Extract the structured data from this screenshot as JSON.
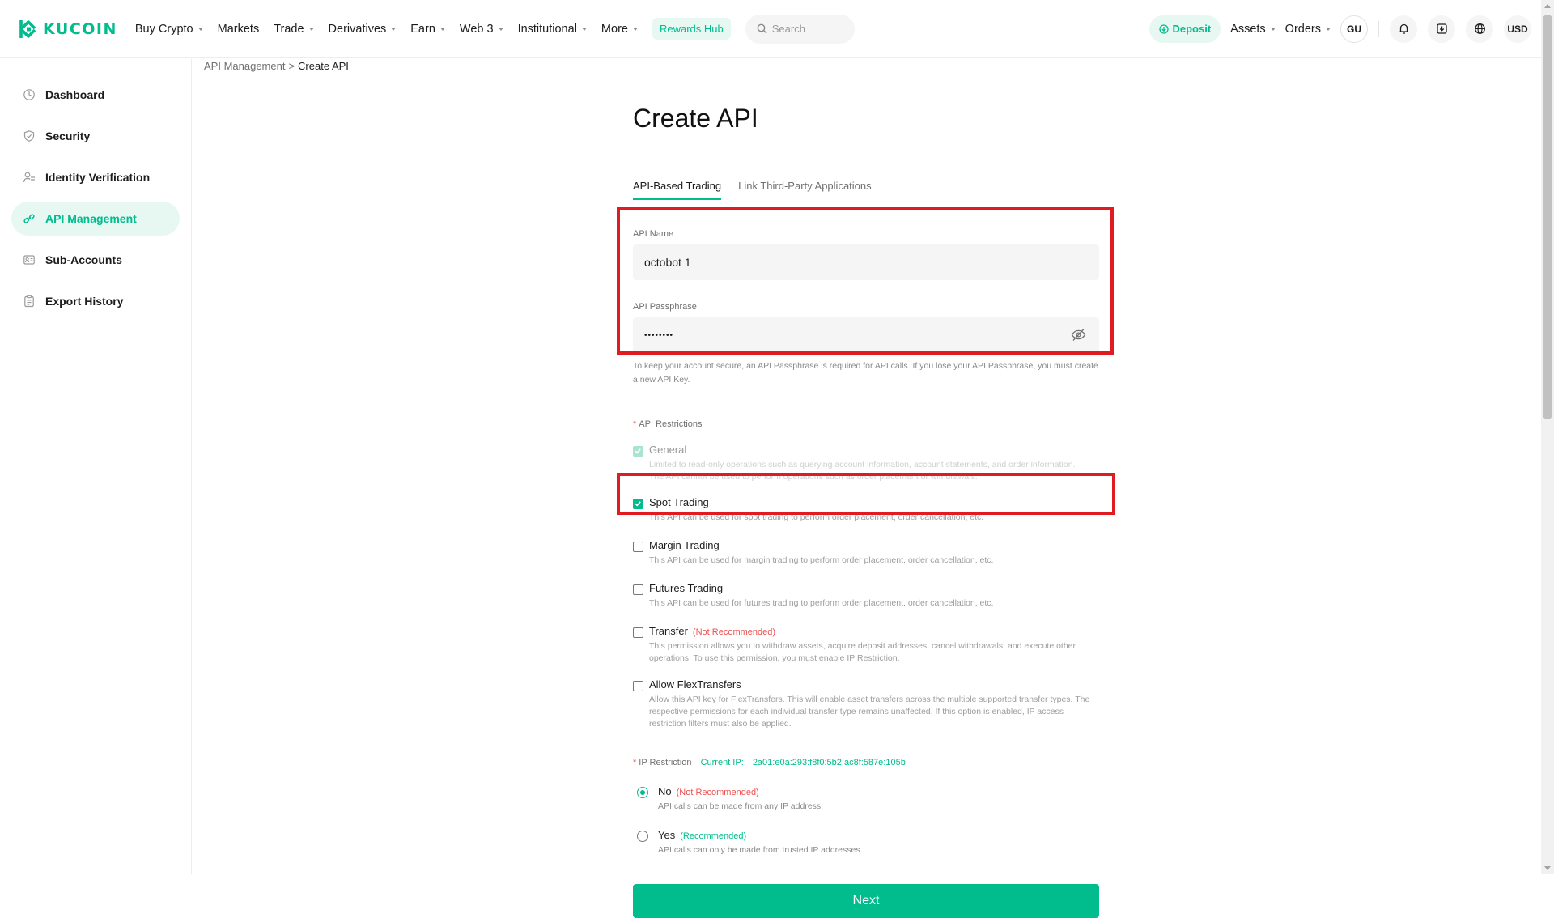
{
  "brand": {
    "name": "KUCOIN",
    "color": "#01bc8d"
  },
  "nav": {
    "items": [
      {
        "label": "Buy Crypto",
        "dropdown": true
      },
      {
        "label": "Markets",
        "dropdown": false
      },
      {
        "label": "Trade",
        "dropdown": true
      },
      {
        "label": "Derivatives",
        "dropdown": true
      },
      {
        "label": "Earn",
        "dropdown": true
      },
      {
        "label": "Web 3",
        "dropdown": true
      },
      {
        "label": "Institutional",
        "dropdown": true
      },
      {
        "label": "More",
        "dropdown": true
      }
    ],
    "rewards": "Rewards Hub",
    "search_placeholder": "Search",
    "deposit": "Deposit",
    "assets": "Assets",
    "orders": "Orders",
    "avatar": "GU",
    "currency": "USD"
  },
  "sidebar": {
    "items": [
      {
        "label": "Dashboard",
        "icon": "dashboard-icon",
        "active": false
      },
      {
        "label": "Security",
        "icon": "shield-icon",
        "active": false
      },
      {
        "label": "Identity Verification",
        "icon": "user-check-icon",
        "active": false
      },
      {
        "label": "API Management",
        "icon": "link-icon",
        "active": true
      },
      {
        "label": "Sub-Accounts",
        "icon": "sub-accounts-icon",
        "active": false
      },
      {
        "label": "Export History",
        "icon": "clipboard-icon",
        "active": false
      }
    ]
  },
  "breadcrumb": {
    "parent": "API Management",
    "separator": ">",
    "current": "Create API"
  },
  "page": {
    "title": "Create API",
    "tabs": [
      "API-Based Trading",
      "Link Third-Party Applications"
    ],
    "api_name_label": "API Name",
    "api_name_value": "octobot 1",
    "passphrase_label": "API Passphrase",
    "passphrase_value": "••••••••",
    "passphrase_hint": "To keep your account secure, an API Passphrase is required for API calls. If you lose your API Passphrase, you must create a new API Key.",
    "restrictions_label": "API Restrictions",
    "required_mark": "*",
    "permissions": [
      {
        "title": "General",
        "desc": "Limited to read-only operations such as querying account information, account statements, and order information. The API cannot be used to perform operations such as order placement or withdrawals.",
        "checked": true,
        "disabled": true,
        "tag": ""
      },
      {
        "title": "Spot Trading",
        "desc": "This API can be used for spot trading to perform order placement, order cancellation, etc.",
        "checked": true,
        "disabled": false,
        "tag": ""
      },
      {
        "title": "Margin Trading",
        "desc": "This API can be used for margin trading to perform order placement, order cancellation, etc.",
        "checked": false,
        "disabled": false,
        "tag": ""
      },
      {
        "title": "Futures Trading",
        "desc": "This API can be used for futures trading to perform order placement, order cancellation, etc.",
        "checked": false,
        "disabled": false,
        "tag": ""
      },
      {
        "title": "Transfer",
        "desc": "This permission allows you to withdraw assets, acquire deposit addresses, cancel withdrawals, and execute other operations. To use this permission, you must enable IP Restriction.",
        "checked": false,
        "disabled": false,
        "tag": "(Not Recommended)"
      },
      {
        "title": "Allow FlexTransfers",
        "desc": "Allow this API key for FlexTransfers. This will enable asset transfers across the multiple supported transfer types. The respective permissions for each individual transfer type remains unaffected. If this option is enabled, IP access restriction filters must also be applied.",
        "checked": false,
        "disabled": false,
        "tag": ""
      }
    ],
    "ip_label": "IP Restriction",
    "current_ip_label": "Current IP:",
    "current_ip": "2a01:e0a:293:f8f0:5b2:ac8f:587e:105b",
    "ip_options": [
      {
        "title": "No",
        "tag": "(Not Recommended)",
        "tag_type": "warn",
        "desc": "API calls can be made from any IP address.",
        "selected": true
      },
      {
        "title": "Yes",
        "tag": "(Recommended)",
        "tag_type": "ok",
        "desc": "API calls can only be made from trusted IP addresses.",
        "selected": false
      }
    ],
    "next": "Next"
  },
  "colors": {
    "accent": "#01bc8d",
    "highlight": "#e11b22",
    "warning": "#f05050"
  }
}
